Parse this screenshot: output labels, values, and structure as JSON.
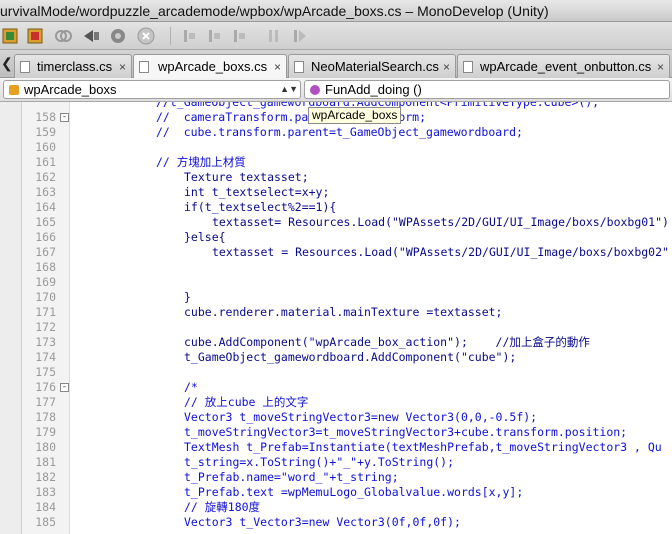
{
  "window": {
    "title": "urvivalMode/wordpuzzle_arcademode/wpbox/wpArcade_boxs.cs – MonoDevelop (Unity)"
  },
  "toolbar": {
    "icons": [
      "build-icon",
      "rebuild-icon",
      "clean-icon",
      "run-icon",
      "debug-icon",
      "stop-icon",
      "step-over-icon",
      "step-into-icon",
      "step-out-icon",
      "pause-icon",
      "continue-icon"
    ]
  },
  "tabs": [
    {
      "label": "timerclass.cs",
      "close": "×",
      "active": false
    },
    {
      "label": "wpArcade_boxs.cs",
      "close": "×",
      "active": true
    },
    {
      "label": "NeoMaterialSearch.cs",
      "close": "×",
      "active": false
    },
    {
      "label": "wpArcade_event_onbutton.cs",
      "close": "×",
      "active": false
    }
  ],
  "navbar": {
    "class_combo": "wpArcade_boxs",
    "method_combo": "FunAdd_doing ()"
  },
  "tooltip": "wpArcade_boxs",
  "editor": {
    "lines": [
      {
        "n": "",
        "fold": "",
        "text": "//t_GameObject_gamewordboard.AddComponent<PrimitiveType.Cube>();",
        "indent": 12,
        "cls": "cmt"
      },
      {
        "n": "158",
        "fold": "-",
        "text": "//  cameraTransform.parent = transform;",
        "indent": 12,
        "cls": "cmt"
      },
      {
        "n": "159",
        "fold": "",
        "text": "//  cube.transform.parent=t_GameObject_gamewordboard;",
        "indent": 12,
        "cls": "cmt"
      },
      {
        "n": "160",
        "fold": "",
        "text": "",
        "indent": 0,
        "cls": ""
      },
      {
        "n": "161",
        "fold": "",
        "text": "// 方塊加上材質",
        "indent": 12,
        "cls": "cmt"
      },
      {
        "n": "162",
        "fold": "",
        "text": "Texture textasset;",
        "indent": 16,
        "cls": "kw"
      },
      {
        "n": "163",
        "fold": "",
        "text": "int t_textselect=x+y;",
        "indent": 16,
        "cls": "kw"
      },
      {
        "n": "164",
        "fold": "",
        "text": "if(t_textselect%2==1){",
        "indent": 16,
        "cls": "kw"
      },
      {
        "n": "165",
        "fold": "",
        "text": "textasset= Resources.Load(\"WPAssets/2D/GUI/UI_Image/boxs/boxbg01\")",
        "indent": 20,
        "cls": "kw"
      },
      {
        "n": "166",
        "fold": "",
        "text": "}else{",
        "indent": 16,
        "cls": "kw"
      },
      {
        "n": "167",
        "fold": "",
        "text": "textasset = Resources.Load(\"WPAssets/2D/GUI/UI_Image/boxs/boxbg02\"",
        "indent": 20,
        "cls": "kw"
      },
      {
        "n": "168",
        "fold": "",
        "text": "",
        "indent": 0,
        "cls": ""
      },
      {
        "n": "169",
        "fold": "",
        "text": "",
        "indent": 0,
        "cls": ""
      },
      {
        "n": "170",
        "fold": "",
        "text": "}",
        "indent": 16,
        "cls": "kw"
      },
      {
        "n": "171",
        "fold": "",
        "text": "cube.renderer.material.mainTexture =textasset;",
        "indent": 16,
        "cls": "kw"
      },
      {
        "n": "172",
        "fold": "",
        "text": "",
        "indent": 0,
        "cls": ""
      },
      {
        "n": "173",
        "fold": "",
        "text": "cube.AddComponent(\"wpArcade_box_action\");    //加上盒子的動作",
        "indent": 16,
        "cls": "kw"
      },
      {
        "n": "174",
        "fold": "",
        "text": "t_GameObject_gamewordboard.AddComponent(\"cube\");",
        "indent": 16,
        "cls": "kw"
      },
      {
        "n": "175",
        "fold": "",
        "text": "",
        "indent": 0,
        "cls": ""
      },
      {
        "n": "176",
        "fold": "-",
        "text": "/*",
        "indent": 16,
        "cls": "cmt"
      },
      {
        "n": "177",
        "fold": "",
        "text": "// 放上cube 上的文字",
        "indent": 16,
        "cls": "cmt"
      },
      {
        "n": "178",
        "fold": "",
        "text": "Vector3 t_moveStringVector3=new Vector3(0,0,-0.5f);",
        "indent": 16,
        "cls": "cmt"
      },
      {
        "n": "179",
        "fold": "",
        "text": "t_moveStringVector3=t_moveStringVector3+cube.transform.position;",
        "indent": 16,
        "cls": "cmt"
      },
      {
        "n": "180",
        "fold": "",
        "text": "TextMesh t_Prefab=Instantiate(textMeshPrefab,t_moveStringVector3 , Qu",
        "indent": 16,
        "cls": "cmt"
      },
      {
        "n": "181",
        "fold": "",
        "text": "t_string=x.ToString()+\"_\"+y.ToString();",
        "indent": 16,
        "cls": "cmt"
      },
      {
        "n": "182",
        "fold": "",
        "text": "t_Prefab.name=\"word_\"+t_string;",
        "indent": 16,
        "cls": "cmt"
      },
      {
        "n": "183",
        "fold": "",
        "text": "t_Prefab.text =wpMemuLogo_Globalvalue.words[x,y];",
        "indent": 16,
        "cls": "cmt"
      },
      {
        "n": "184",
        "fold": "",
        "text": "// 旋轉180度",
        "indent": 16,
        "cls": "cmt"
      },
      {
        "n": "185",
        "fold": "",
        "text": "Vector3 t_Vector3=new Vector3(0f,0f,0f);",
        "indent": 16,
        "cls": "cmt"
      }
    ]
  }
}
